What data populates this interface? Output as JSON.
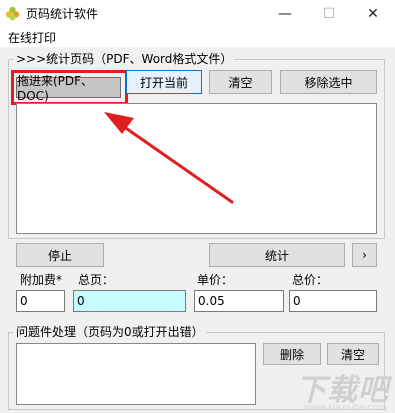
{
  "window": {
    "title": "页码统计软件",
    "minimize": "—",
    "maximize": "☐",
    "close": "✕"
  },
  "menu": {
    "online_print": "在线打印"
  },
  "file_group": {
    "legend": ">>>统计页码（PDF、Word格式文件）",
    "drag_in": "拖进来(PDF、DOC)",
    "open_current": "打开当前",
    "clear": "清空",
    "remove_selected": "移除选中"
  },
  "controls": {
    "stop": "停止",
    "count": "统计",
    "more": "›"
  },
  "fields": {
    "surcharge_label": "附加费*",
    "total_pages_label": "总页：",
    "unit_price_label": "单价：",
    "total_price_label": "总价：",
    "surcharge_value": "0",
    "total_pages_value": "0",
    "unit_price_value": "0.05",
    "total_price_value": "0"
  },
  "problem_group": {
    "legend": "问题件处理（页码为0或打开出错）",
    "delete": "删除",
    "clear": "清空"
  },
  "watermark": {
    "text": "下载吧",
    "url": "www.xiazaiba.com"
  },
  "colors": {
    "annotation_red": "#e02020",
    "cyan_field": "#c6fcff"
  }
}
